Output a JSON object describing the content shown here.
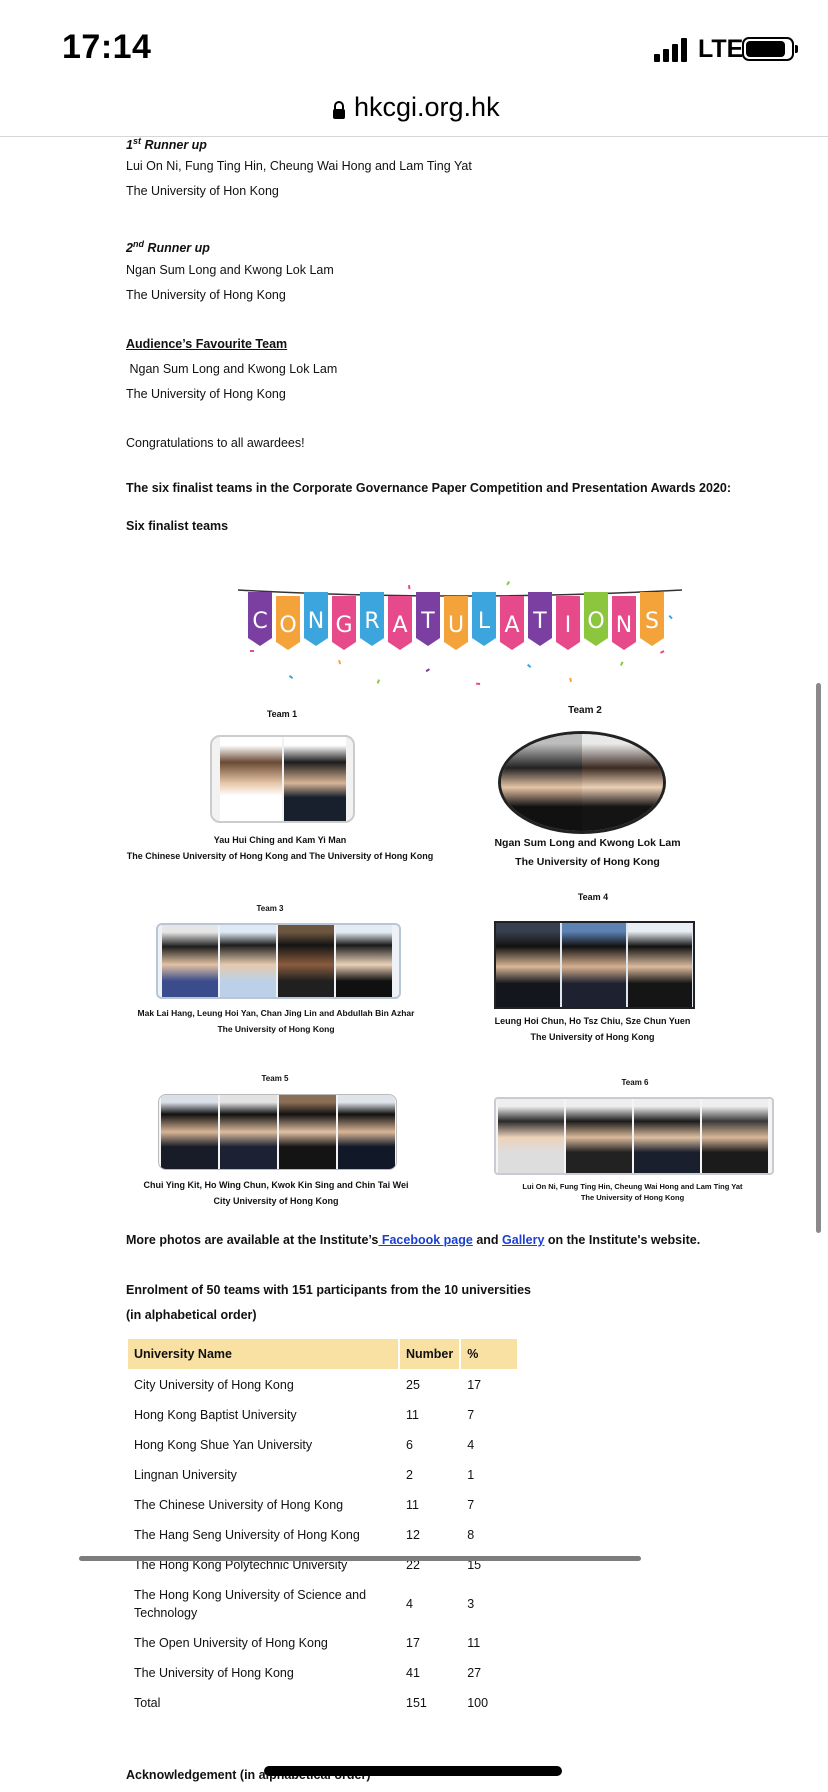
{
  "status": {
    "time": "17:14",
    "network": "LTE"
  },
  "browser": {
    "url": "hkcgi.org.hk"
  },
  "awards": {
    "first_runner_up": {
      "label_main": "1",
      "label_sup": "st",
      "label_rest": " Runner up",
      "team": "Lui On Ni, Fung Ting Hin, Cheung Wai Hong and Lam Ting Yat",
      "university": "The University of Hon Kong"
    },
    "second_runner_up": {
      "label_main": "2",
      "label_sup": "nd",
      "label_rest": " Runner up",
      "team": "Ngan Sum Long and Kwong Lok Lam",
      "university": "The University of Hong Kong"
    },
    "audience_favourite": {
      "label": "Audience’s Favourite Team",
      "team": " Ngan Sum Long and Kwong Lok Lam",
      "university": "The University of Hong Kong"
    },
    "congrats": "Congratulations to all awardees!"
  },
  "finalists_heading": "The six finalist teams in the Corporate Governance Paper Competition and Presentation Awards 2020:",
  "finalists_subheading": "Six finalist teams",
  "banner_letters": [
    "C",
    "O",
    "N",
    "G",
    "R",
    "A",
    "T",
    "U",
    "L",
    "A",
    "T",
    "I",
    "O",
    "N",
    "S"
  ],
  "banner_colors": [
    "#7a3fa0",
    "#f4a23a",
    "#3da5de",
    "#e64a8a",
    "#3da5de",
    "#e64a8a",
    "#7a3fa0",
    "#f4a23a",
    "#3da5de",
    "#e64a8a",
    "#7a3fa0",
    "#e64a8a",
    "#8cc63e",
    "#e64a8a",
    "#f4a23a"
  ],
  "teams": [
    {
      "label": "Team 1",
      "names": "Yau Hui Ching and Kam Yi Man",
      "university": "The Chinese University of Hong Kong and The University of Hong Kong"
    },
    {
      "label": "Team 2",
      "names": "Ngan Sum Long and Kwong Lok Lam",
      "university": "The University of Hong Kong"
    },
    {
      "label": "Team 3",
      "names": "Mak Lai Hang, Leung Hoi Yan, Chan Jing Lin and Abdullah Bin Azhar",
      "university": "The University of Hong Kong"
    },
    {
      "label": "Team 4",
      "names": "Leung Hoi Chun, Ho Tsz Chiu, Sze Chun Yuen",
      "university": "The University of Hong Kong"
    },
    {
      "label": "Team 5",
      "names": "Chui Ying Kit, Ho Wing Chun, Kwok Kin Sing and Chin Tai Wei",
      "university": "City University of Hong Kong"
    },
    {
      "label": "Team 6",
      "names": "Lui On Ni, Fung Ting Hin, Cheung Wai Hong and Lam Ting Yat",
      "university": "The University of Hong Kong"
    }
  ],
  "more_photos": {
    "prefix": "More photos are available at the Institute’s",
    "facebook": " Facebook page",
    "and": " and ",
    "gallery": "Gallery",
    "suffix": " on the Institute's website."
  },
  "enrolment": {
    "line1": "Enrolment of 50 teams with 151 participants from the 10 universities",
    "line2": "(in alphabetical order)"
  },
  "table": {
    "headers": [
      "University Name",
      "Number",
      "%"
    ],
    "rows": [
      [
        "City University of Hong Kong",
        "25",
        "17"
      ],
      [
        "Hong Kong Baptist University",
        "11",
        "7"
      ],
      [
        "Hong Kong Shue Yan University",
        "6",
        "4"
      ],
      [
        "Lingnan University",
        "2",
        "1"
      ],
      [
        "The Chinese University of Hong Kong",
        "11",
        "7"
      ],
      [
        "The Hang Seng University of Hong Kong",
        "12",
        "8"
      ],
      [
        "The Hong Kong Polytechnic University",
        "22",
        "15"
      ],
      [
        "The Hong Kong University of Science and Technology",
        "4",
        "3"
      ],
      [
        "The Open University of Hong Kong",
        "17",
        "11"
      ],
      [
        "The University of Hong Kong",
        "41",
        "27"
      ],
      [
        "Total",
        "151",
        "100"
      ]
    ]
  },
  "acknowledgement": "Acknowledgement (in alphabetical order)"
}
